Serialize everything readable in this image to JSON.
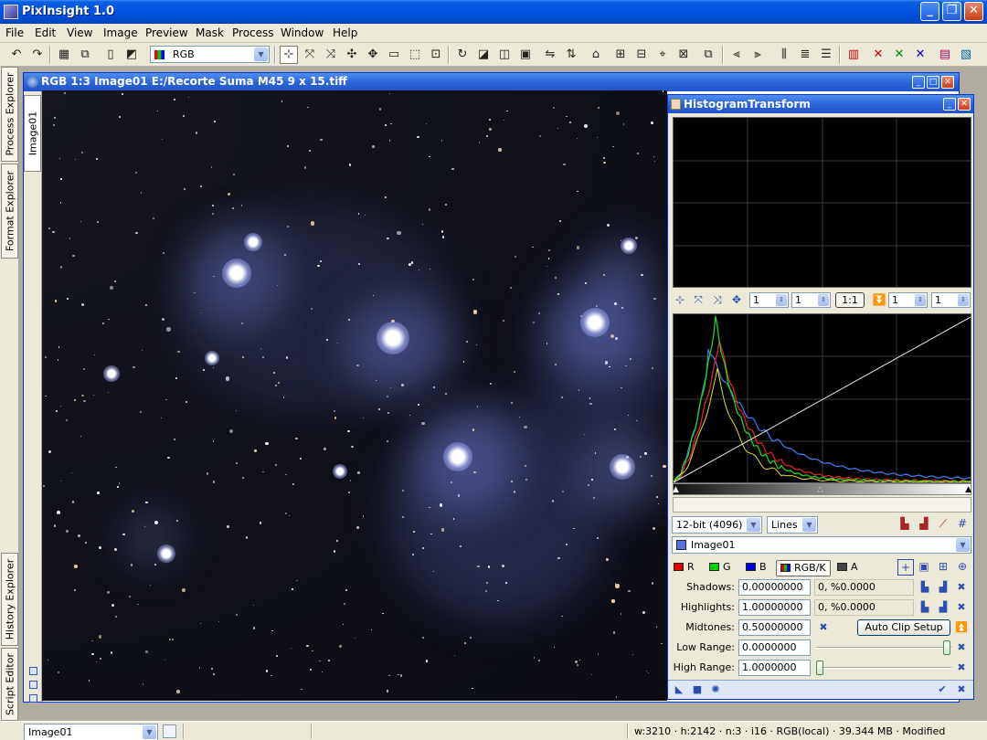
{
  "app": {
    "title": "PixInsight 1.0"
  },
  "menu": [
    "File",
    "Edit",
    "View",
    "Image",
    "Preview",
    "Mask",
    "Process",
    "Window",
    "Help"
  ],
  "toolbar": {
    "color_space": "RGB"
  },
  "side_tabs": [
    "Process Explorer",
    "Format Explorer",
    "History Explorer",
    "Script Editor"
  ],
  "image_window": {
    "title": "RGB 1:3 Image01 E:/Recorte Suma M45 9 x 15.tiff",
    "tab": "Image01"
  },
  "histogram": {
    "title": "HistogramTransform",
    "spin_values": [
      "1",
      "1",
      "1",
      "1"
    ],
    "zoom_label": "1:1",
    "resolution": "12-bit (4096)",
    "graph_style": "Lines",
    "view": "Image01",
    "channels": [
      {
        "key": "R",
        "color": "#e00000"
      },
      {
        "key": "G",
        "color": "#00d000"
      },
      {
        "key": "B",
        "color": "#0000e0"
      },
      {
        "key": "RGB/K",
        "color": "#555555"
      },
      {
        "key": "A",
        "color": "#444444"
      }
    ],
    "params": {
      "shadows_label": "Shadows:",
      "shadows": "0.00000000",
      "shadows_clip": "0, %0.0000",
      "highlights_label": "Highlights:",
      "highlights": "1.00000000",
      "highlights_clip": "0, %0.0000",
      "midtones_label": "Midtones:",
      "midtones": "0.50000000",
      "auto_clip": "Auto Clip Setup",
      "low_range_label": "Low Range:",
      "low_range": "0.0000000",
      "high_range_label": "High Range:",
      "high_range": "1.0000000"
    }
  },
  "status": {
    "view": "Image01",
    "info": "w:3210 · h:2142 · n:3 · i16 · RGB(local) · 39.344 MB · Modified"
  },
  "colors": {
    "xp_blue": "#0054e3",
    "histo_red": "#e02020",
    "histo_green": "#20d020",
    "histo_blue": "#3a78e8",
    "nebula": "#6f7fd8"
  }
}
